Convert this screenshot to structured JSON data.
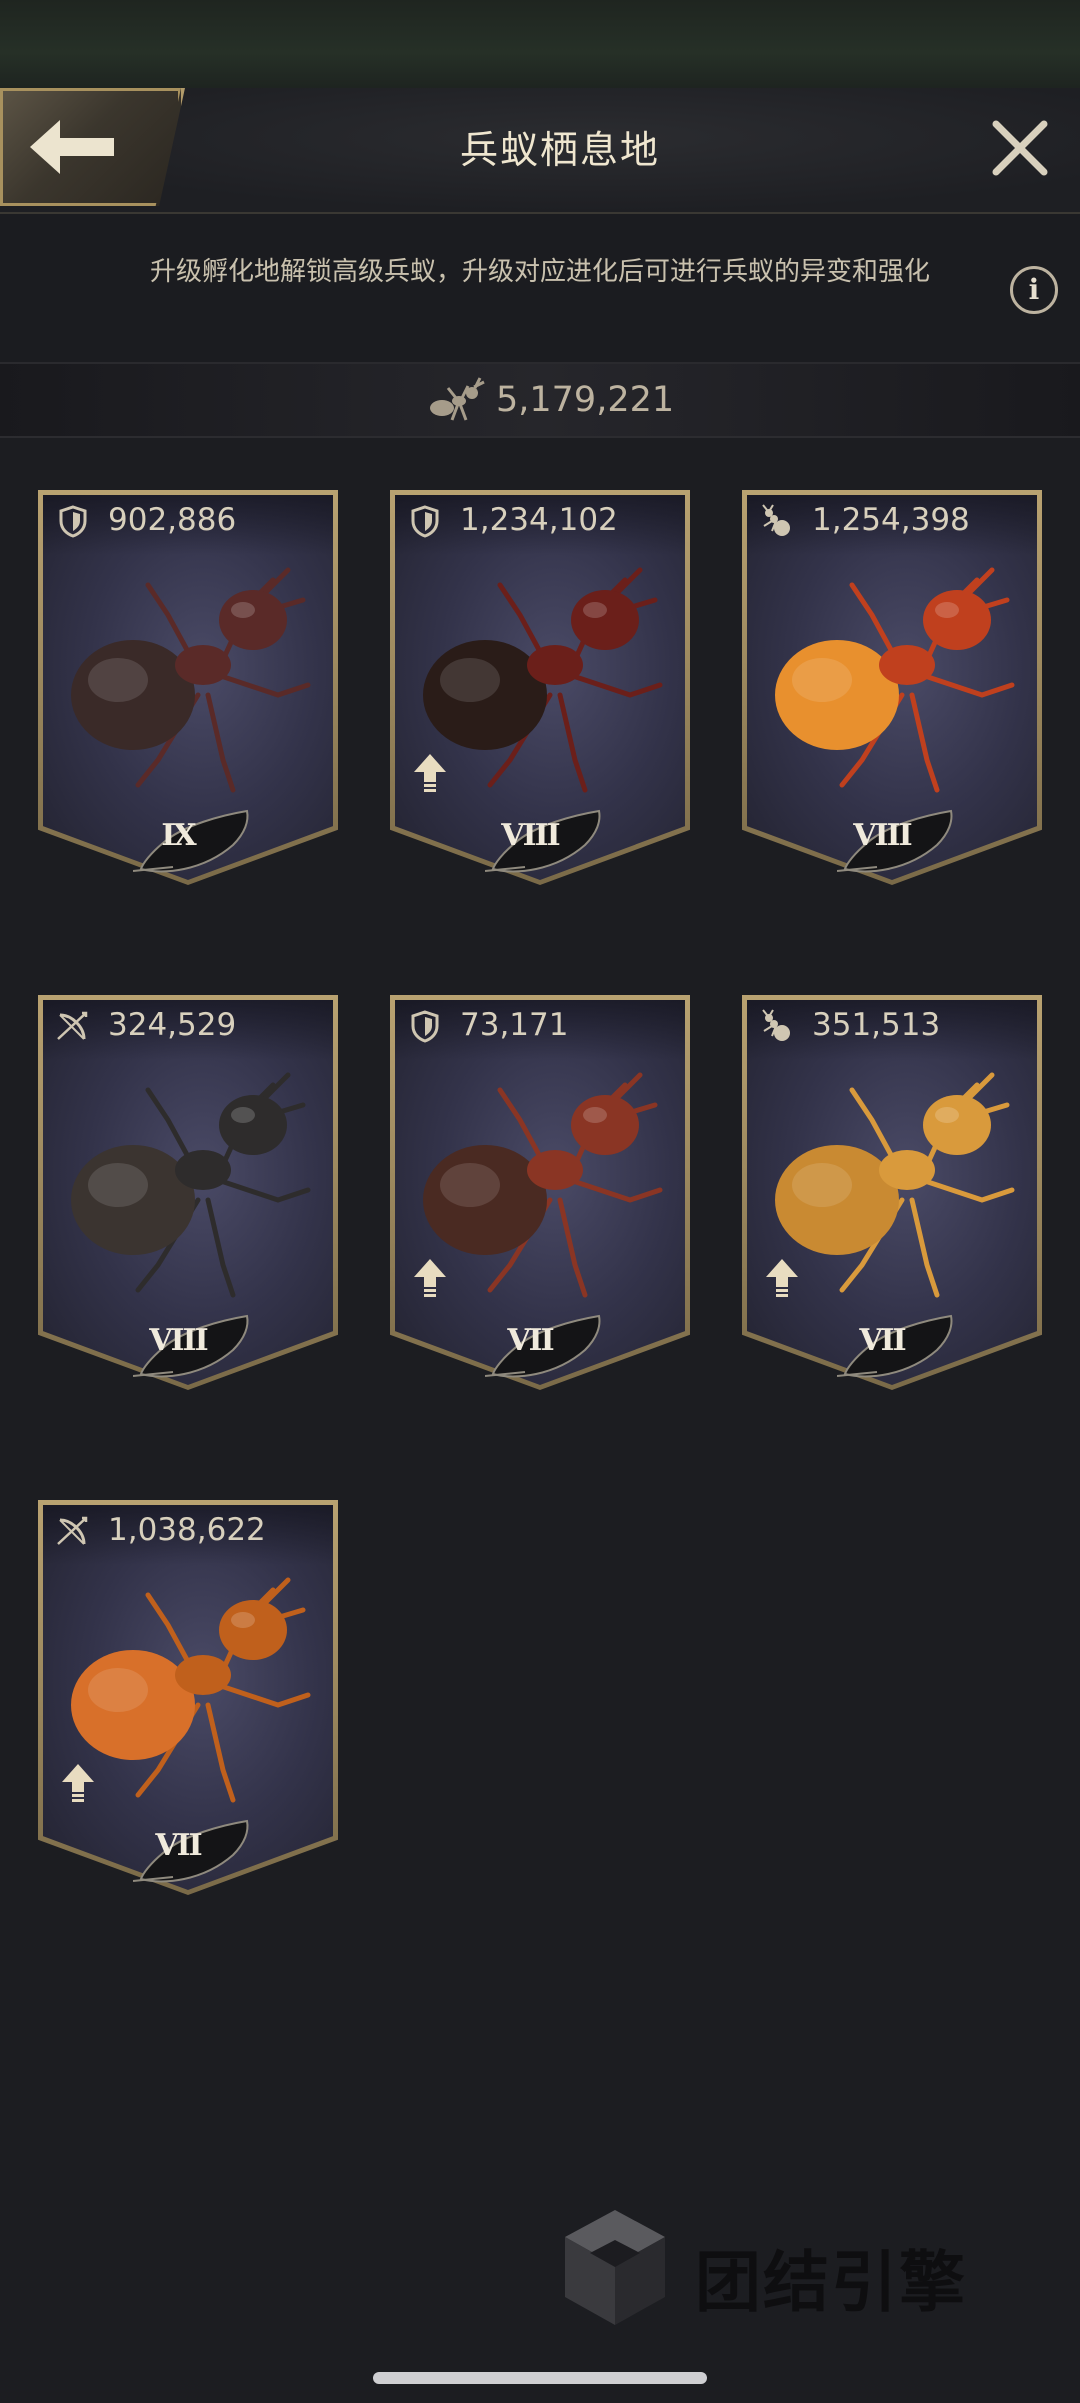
{
  "header": {
    "title": "兵蚁栖息地",
    "back_icon": "arrow-left-icon",
    "close_icon": "close-icon"
  },
  "description": {
    "text": "升级孵化地解锁高级兵蚁，升级对应进化后可进行兵蚁的异变和强化",
    "info_icon": "i"
  },
  "total": {
    "icon": "ant-icon",
    "value": "5,179,221"
  },
  "cards": [
    {
      "type": "shield",
      "power": "902,886",
      "level": "IX",
      "upgrade": false,
      "body": "#5a2a28",
      "abdomen": "#3a2a28"
    },
    {
      "type": "shield",
      "power": "1,234,102",
      "level": "VIII",
      "upgrade": true,
      "body": "#6b1f1a",
      "abdomen": "#2a1c18"
    },
    {
      "type": "worker",
      "power": "1,254,398",
      "level": "VIII",
      "upgrade": false,
      "body": "#c0401e",
      "abdomen": "#e8902e"
    },
    {
      "type": "bow",
      "power": "324,529",
      "level": "VIII",
      "upgrade": false,
      "body": "#2e2c2c",
      "abdomen": "#3b3430"
    },
    {
      "type": "shield",
      "power": "73,171",
      "level": "VII",
      "upgrade": true,
      "body": "#8a3524",
      "abdomen": "#4a2a22"
    },
    {
      "type": "worker",
      "power": "351,513",
      "level": "VII",
      "upgrade": true,
      "body": "#d99a3c",
      "abdomen": "#c98a32"
    },
    {
      "type": "bow",
      "power": "1,038,622",
      "level": "VII",
      "upgrade": true,
      "body": "#c0601c",
      "abdomen": "#d8702a"
    }
  ],
  "watermark": {
    "text": "团结引擎"
  }
}
